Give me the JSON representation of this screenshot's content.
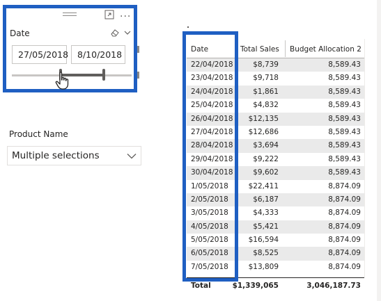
{
  "date_slicer": {
    "title": "Date",
    "start_value": "27/05/2018",
    "end_value": "8/10/2018",
    "icons": {
      "grip": "drag-grip-icon",
      "focus": "focus-mode-icon",
      "more": "more-options-icon",
      "eraser": "clear-selections-icon",
      "chevron": "chevron-down-icon",
      "cursor": "hand-pointer-icon"
    },
    "more_glyph": "···"
  },
  "product_slicer": {
    "title": "Product Name",
    "value": "Multiple selections"
  },
  "table": {
    "columns": [
      "Date",
      "Total Sales",
      "Budget Allocation 2"
    ],
    "rows": [
      [
        "22/04/2018",
        "$8,739",
        "8,589.43"
      ],
      [
        "23/04/2018",
        "$9,718",
        "8,589.43"
      ],
      [
        "24/04/2018",
        "$1,861",
        "8,589.43"
      ],
      [
        "25/04/2018",
        "$4,832",
        "8,589.43"
      ],
      [
        "26/04/2018",
        "$12,135",
        "8,589.43"
      ],
      [
        "27/04/2018",
        "$12,686",
        "8,589.43"
      ],
      [
        "28/04/2018",
        "$3,694",
        "8,589.43"
      ],
      [
        "29/04/2018",
        "$9,222",
        "8,589.43"
      ],
      [
        "30/04/2018",
        "$9,602",
        "8,589.43"
      ],
      [
        "1/05/2018",
        "$22,411",
        "8,874.09"
      ],
      [
        "2/05/2018",
        "$6,187",
        "8,874.09"
      ],
      [
        "3/05/2018",
        "$4,333",
        "8,874.09"
      ],
      [
        "4/05/2018",
        "$5,421",
        "8,874.09"
      ],
      [
        "5/05/2018",
        "$16,594",
        "8,874.09"
      ],
      [
        "6/05/2018",
        "$8,525",
        "8,874.09"
      ],
      [
        "7/05/2018",
        "$13,809",
        "8,874.09"
      ]
    ],
    "total": {
      "label": "Total",
      "sales": "$1,339,065",
      "budget": "3,046,187.73"
    }
  },
  "colors": {
    "highlight_frame": "#1f5fc2",
    "row_alt": "#eaeaea",
    "text": "#252423"
  }
}
